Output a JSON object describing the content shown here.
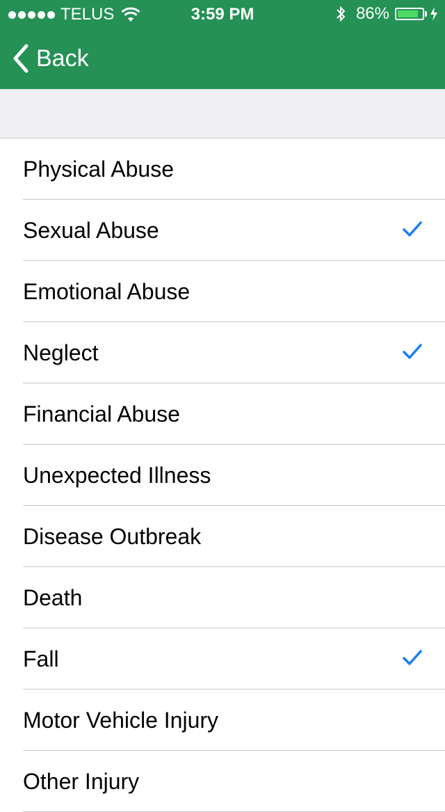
{
  "status_bar": {
    "carrier": "TELUS",
    "time": "3:59 PM",
    "battery": "86%",
    "battery_level": 0.86,
    "icons": [
      "signal-dots-icon",
      "wifi-icon",
      "bluetooth-icon",
      "battery-icon",
      "charging-bolt-icon"
    ]
  },
  "nav": {
    "back_label": "Back",
    "back_icon": "chevron-left-icon"
  },
  "colors": {
    "nav_bar": "#259155",
    "section_background": "#efeff4",
    "checkmark": "#1a7ef5",
    "separator": "#c8c7cc"
  },
  "list": {
    "items": [
      {
        "label": "Physical Abuse",
        "checked": false
      },
      {
        "label": "Sexual Abuse",
        "checked": true
      },
      {
        "label": "Emotional Abuse",
        "checked": false
      },
      {
        "label": "Neglect",
        "checked": true
      },
      {
        "label": "Financial Abuse",
        "checked": false
      },
      {
        "label": "Unexpected Illness",
        "checked": false
      },
      {
        "label": "Disease Outbreak",
        "checked": false
      },
      {
        "label": "Death",
        "checked": false
      },
      {
        "label": "Fall",
        "checked": true
      },
      {
        "label": "Motor Vehicle Injury",
        "checked": false
      },
      {
        "label": "Other Injury",
        "checked": false
      }
    ]
  }
}
